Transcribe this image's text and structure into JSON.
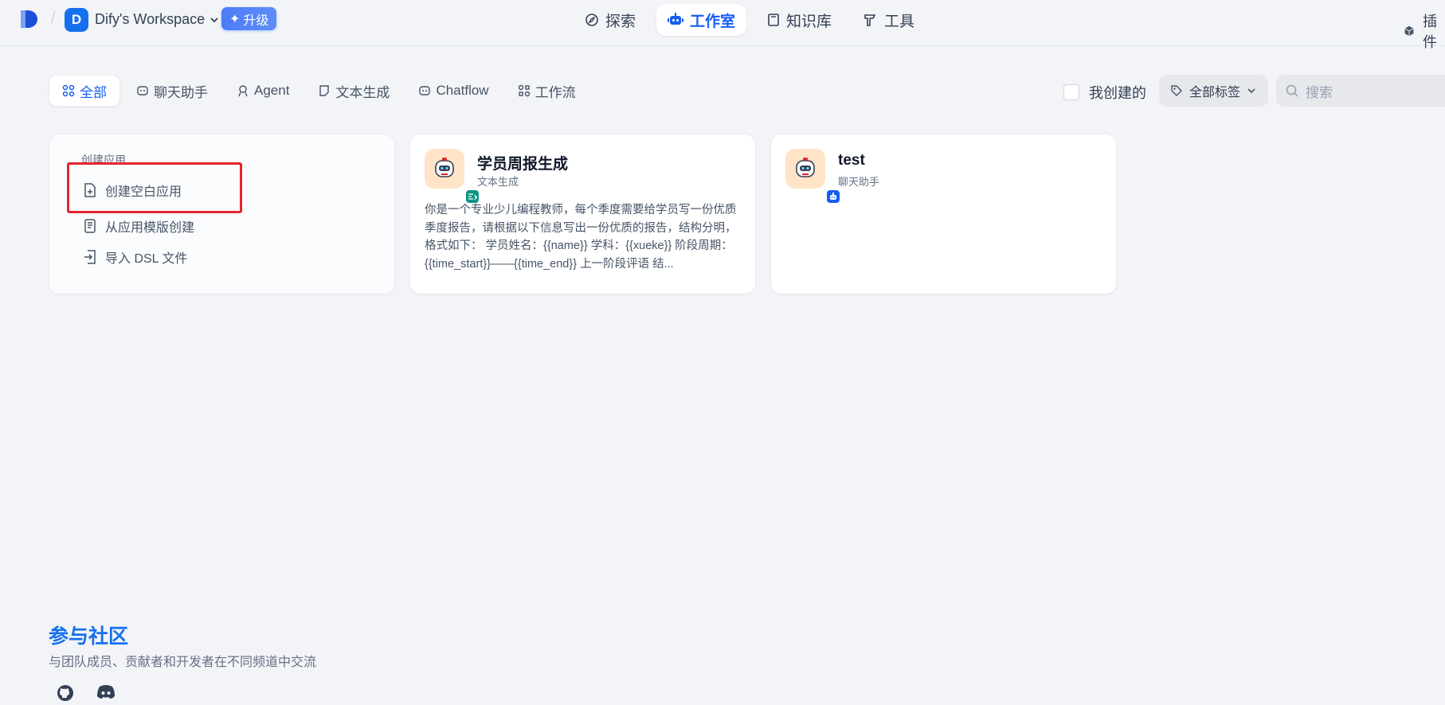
{
  "header": {
    "workspace_initial": "D",
    "workspace_name": "Dify's Workspace",
    "upgrade_label": "升级",
    "nav": [
      {
        "label": "探索",
        "icon": "compass-icon"
      },
      {
        "label": "工作室",
        "icon": "robot-icon"
      },
      {
        "label": "知识库",
        "icon": "book-icon"
      },
      {
        "label": "工具",
        "icon": "hammer-icon"
      }
    ],
    "plugin_label": "插件"
  },
  "filters": {
    "tabs": [
      {
        "label": "全部",
        "icon": "grid-icon"
      },
      {
        "label": "聊天助手",
        "icon": "chat-icon"
      },
      {
        "label": "Agent",
        "icon": "agent-icon"
      },
      {
        "label": "文本生成",
        "icon": "document-icon"
      },
      {
        "label": "Chatflow",
        "icon": "chatflow-icon"
      },
      {
        "label": "工作流",
        "icon": "workflow-icon"
      }
    ],
    "mine_label": "我创建的",
    "tag_label": "全部标签",
    "search_placeholder": "搜索"
  },
  "create_card": {
    "heading": "创建应用",
    "items": [
      {
        "label": "创建空白应用",
        "icon": "new-file-icon"
      },
      {
        "label": "从应用模版创建",
        "icon": "template-icon"
      },
      {
        "label": "导入 DSL 文件",
        "icon": "import-icon"
      }
    ]
  },
  "apps": [
    {
      "name": "学员周报生成",
      "type": "文本生成",
      "badge_color": "#0e9384",
      "description": "你是一个专业少儿编程教师，每个季度需要给学员写一份优质季度报告，请根据以下信息写出一份优质的报告，结构分明，格式如下： 学员姓名：{{name}} 学科：{{xueke}} 阶段周期：{{time_start}}——{{time_end}} 上一阶段评语 结..."
    },
    {
      "name": "test",
      "type": "聊天助手",
      "badge_color": "#155eef",
      "description": ""
    }
  ],
  "community": {
    "title": "参与社区",
    "subtitle": "与团队成员、贡献者和开发者在不同频道中交流"
  },
  "colors": {
    "accent": "#155eef",
    "highlight": "#e4262b",
    "background": "#f2f4f7"
  }
}
